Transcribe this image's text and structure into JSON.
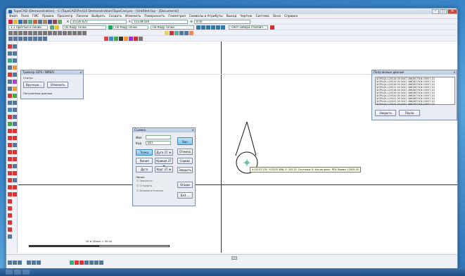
{
  "app": {
    "title": "TopoCAD (Demonstration) - C:\\TopoCAD\\Pro\\16 Demonstration\\TopoCad.pro - [Untitled.tcp - [Document]]"
  },
  "menu": [
    "Файл",
    "Поле",
    "ГИС",
    "Правка",
    "Просмотр",
    "Панели",
    "Выбрать",
    "Создать",
    "Изменить",
    "Поверхность",
    "Геометрия",
    "Символы и Атрибуты",
    "Выход",
    "Чертеж",
    "Система",
    "Окно",
    "Справка"
  ],
  "toolbar": {
    "x_label": "X",
    "x_value": "15126.625",
    "y_label": "Y",
    "y_value": "15238.026",
    "h_label": "H",
    "h_value": "0.00",
    "linetype": "1.1 Простые и линии",
    "layer": "По Коду Точки",
    "layer2": "По Коду Точки",
    "line_style": "По Коду Точки",
    "preset": "<Нет набора стилей>"
  },
  "tracer_panel": {
    "title": "Трайсер (GPS / NMEA)",
    "status_label": "Статус",
    "manual_button": "Вручную...",
    "cancel_button": "Отменить",
    "received_label": "Полученные данные"
  },
  "received_panel": {
    "title": "Полученные данные",
    "rows": [
      "$GPGGA,120514.00,5047.08628176,N,03057.33",
      "$GPGGA,120515.00,5047.08628276,N,03057.33",
      "$GPGGA,120516.00,5047.08628376,N,03057.33",
      "$GPGGA,120517.00,5047.08628476,N,03057.33",
      "$GPGGA,120518.00,5047.08628576,N,03057.33",
      "$GPGGA,120519.00,5047.08628676,N,03057.33",
      "$GPGGA,120520.00,5047.08628776,N,03057.33",
      "$GPGGA,120521.00,5047.08628876,N,03057.33",
      "$GPGGA,120522.00,5047.08628976,N,03057.33",
      "$GPGGA,120523.00,5047.08629076,N,03057.33"
    ],
    "close_button": "Закрыть",
    "clear_button": "Пауза"
  },
  "survey_dialog": {
    "title": "Съемка",
    "name_label": "Имя",
    "name_value": "",
    "code_label": "Код",
    "code_value": "007",
    "point_button": "Точка",
    "arc2_button": "Дуга 2Т ж",
    "line_button": "Линия",
    "curve2_button": "Кривая 2Т ж",
    "arc_button": "Дуга",
    "circle2_button": "Круг 2Т ж",
    "add_group_label": "Линия",
    "chk1": "Замкнуто",
    "chk2": "Сгладить",
    "chk3": "Вспомогательная",
    "run_button": "Run",
    "undo_button": "Отмена",
    "service_button": "Сервис",
    "close_button": "Закрыть",
    "option_button": "Опции",
    "exit_button": "Exit ..."
  },
  "tooltip": "X:15137.235, Y:15237.806, Z: 202.25, Спутники: 8, Кач-во фикс: RTK, Время: 12053.00",
  "scale_text": "10 м (Zoom = 50 m)"
}
